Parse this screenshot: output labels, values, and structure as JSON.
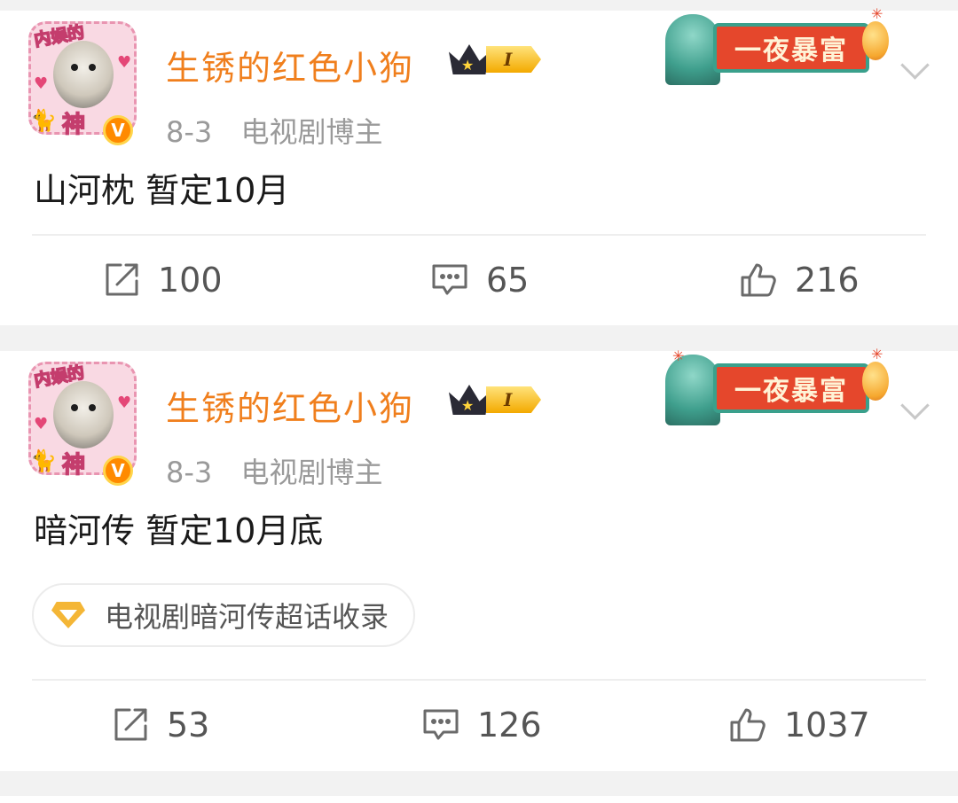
{
  "posts": [
    {
      "username": "生锈的红色小狗",
      "rank_level": "I",
      "date": "8-3",
      "role": "电视剧博主",
      "avatar_text_top": "内娱的",
      "avatar_text_bottom": "神",
      "banner_text": "一夜暴富",
      "text": "山河枕 暂定10月",
      "topic": null,
      "actions": {
        "repost": "100",
        "comment": "65",
        "like": "216"
      }
    },
    {
      "username": "生锈的红色小狗",
      "rank_level": "I",
      "date": "8-3",
      "role": "电视剧博主",
      "avatar_text_top": "内娱的",
      "avatar_text_bottom": "神",
      "banner_text": "一夜暴富",
      "text": "暗河传 暂定10月底",
      "topic": "电视剧暗河传超话收录",
      "actions": {
        "repost": "53",
        "comment": "126",
        "like": "1037"
      }
    }
  ],
  "icons": {
    "repost": "repost-icon",
    "comment": "comment-icon",
    "like": "thumbs-up-icon",
    "more": "chevron-down-icon",
    "verified": "verified-v-icon",
    "crown": "crown-icon",
    "topic": "diamond-icon"
  },
  "colors": {
    "username": "#f07f1d",
    "meta": "#9a9a9a",
    "banner_red": "#e5472c",
    "accent_teal": "#3aa08c"
  }
}
